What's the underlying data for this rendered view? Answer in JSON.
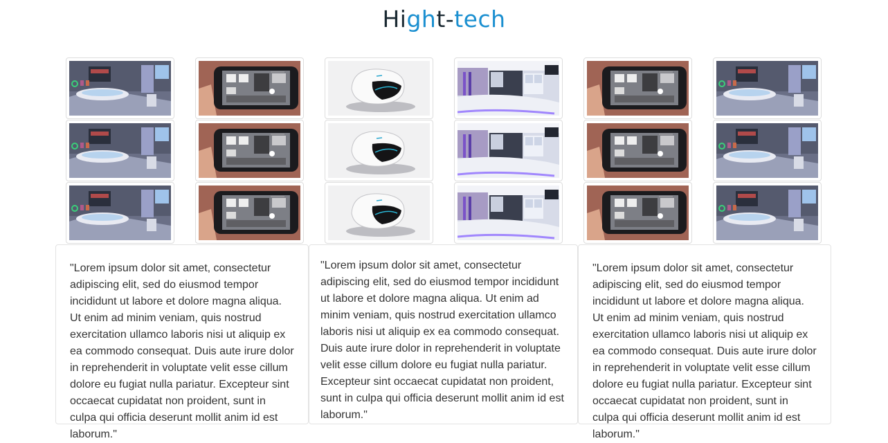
{
  "header": {
    "logo_parts": [
      "Hi",
      "gh",
      "t-",
      "tech"
    ]
  },
  "gallery": {
    "image_kinds": [
      "bathroom",
      "phone",
      "device",
      "kitchen",
      "phone",
      "bathroom"
    ],
    "image_labels": [
      "bathroom-image",
      "smartphone-app-image",
      "smart-device-image",
      "kitchen-image",
      "smartphone-app-image",
      "bathroom-image"
    ],
    "rows": 3
  },
  "cards": [
    {
      "text": "\"Lorem ipsum dolor sit amet, consectetur adipiscing elit, sed do eiusmod tempor incididunt ut labore et dolore magna aliqua. Ut enim ad minim veniam, quis nostrud exercitation ullamco laboris nisi ut aliquip ex ea commodo consequat. Duis aute irure dolor in reprehenderit in voluptate velit esse cillum dolore eu fugiat nulla pariatur. Excepteur sint occaecat cupidatat non proident, sunt in culpa qui officia deserunt mollit anim id est laborum.\""
    },
    {
      "text": "\"Lorem ipsum dolor sit amet, consectetur adipiscing elit, sed do eiusmod tempor incididunt ut labore et dolore magna aliqua. Ut enim ad minim veniam, quis nostrud exercitation ullamco laboris nisi ut aliquip ex ea commodo consequat. Duis aute irure dolor in reprehenderit in voluptate velit esse cillum dolore eu fugiat nulla pariatur. Excepteur sint occaecat cupidatat non proident, sunt in culpa qui officia deserunt mollit anim id est laborum.\""
    },
    {
      "text": "\"Lorem ipsum dolor sit amet, consectetur adipiscing elit, sed do eiusmod tempor incididunt ut labore et dolore magna aliqua. Ut enim ad minim veniam, quis nostrud exercitation ullamco laboris nisi ut aliquip ex ea commodo consequat. Duis aute irure dolor in reprehenderit in voluptate velit esse cillum dolore eu fugiat nulla pariatur. Excepteur sint occaecat cupidatat non proident, sunt in culpa qui officia deserunt mollit anim id est laborum.\""
    }
  ],
  "colors": {
    "logo_dark": "#1b2a33",
    "logo_accent": "#1a8fd0",
    "text": "#333333",
    "border": "#dddddd"
  }
}
